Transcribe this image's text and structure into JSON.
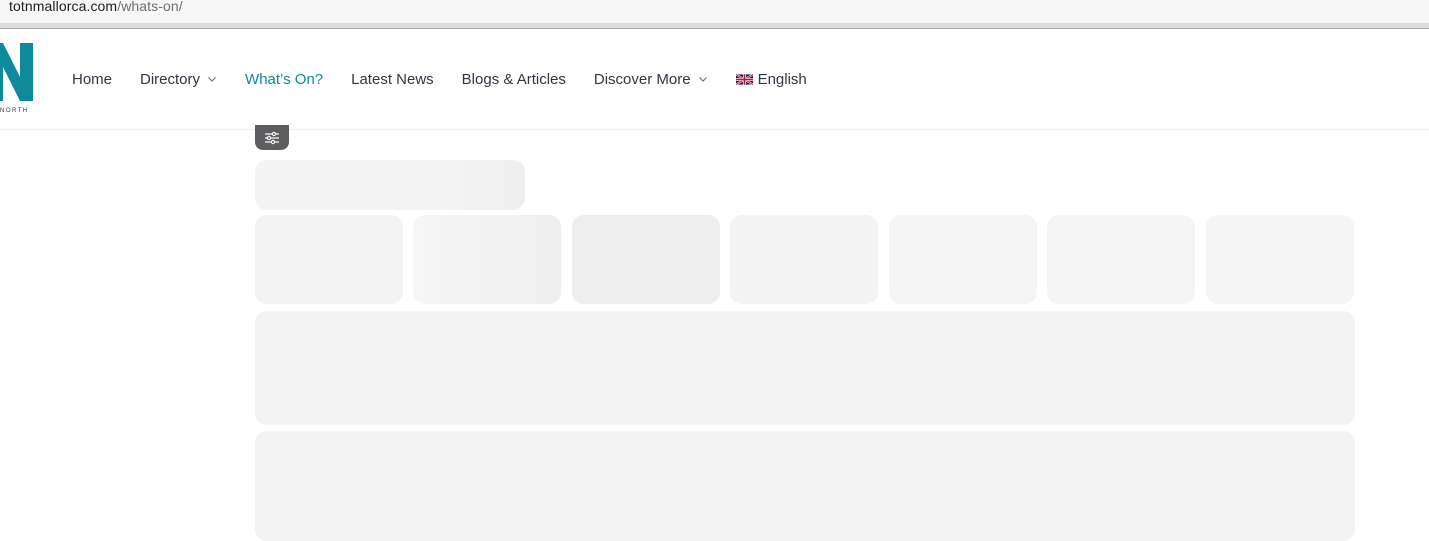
{
  "browser": {
    "url_domain": "totnmallorca.com",
    "url_path": "/whats-on/"
  },
  "logo": {
    "letter": "N",
    "tagline": "NORTH",
    "color": "#0e8a9c"
  },
  "nav": {
    "items": [
      {
        "label": "Home",
        "dropdown": false,
        "active": false
      },
      {
        "label": "Directory",
        "dropdown": true,
        "active": false
      },
      {
        "label": "What’s On?",
        "dropdown": false,
        "active": true
      },
      {
        "label": "Latest News",
        "dropdown": false,
        "active": false
      },
      {
        "label": "Blogs & Articles",
        "dropdown": false,
        "active": false
      },
      {
        "label": "Discover More",
        "dropdown": true,
        "active": false
      }
    ],
    "language": {
      "label": "English",
      "icon": "uk-flag-icon"
    },
    "text_color": "#2f3742",
    "active_color": "#0e8a9c"
  },
  "filter": {
    "icon": "sliders-icon"
  },
  "skeleton": {
    "color": "#f3f3f4",
    "card_count": 7
  }
}
